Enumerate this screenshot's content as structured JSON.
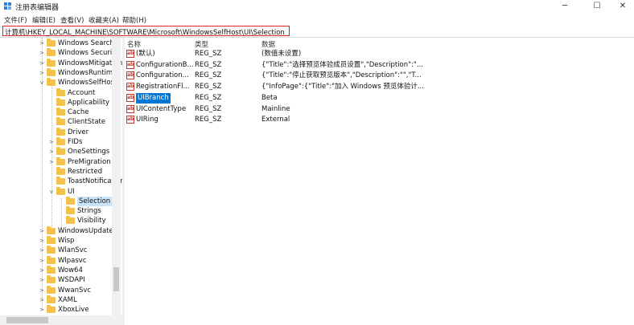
{
  "window": {
    "title": "注册表编辑器",
    "min_glyph": "─",
    "max_glyph": "☐",
    "close_glyph": "✕"
  },
  "menu": [
    {
      "label": "文件(F)"
    },
    {
      "label": "编辑(E)"
    },
    {
      "label": "查看(V)"
    },
    {
      "label": "收藏夹(A)"
    },
    {
      "label": "帮助(H)"
    }
  ],
  "address": {
    "path": "计算机\\HKEY_LOCAL_MACHINE\\SOFTWARE\\Microsoft\\WindowsSelfHost\\UI\\Selection"
  },
  "tree": [
    {
      "label": "Windows Search",
      "chevron": ">",
      "selected": false
    },
    {
      "label": "Windows Security",
      "chevron": ">",
      "selected": false
    },
    {
      "label": "WindowsMitigation",
      "chevron": ">",
      "selected": false
    },
    {
      "label": "WindowsRuntime",
      "chevron": ">",
      "selected": false
    },
    {
      "label": "WindowsSelfHost",
      "chevron": "v",
      "selected": false
    },
    {
      "label": "Account",
      "chevron": "",
      "selected": false
    },
    {
      "label": "Applicability",
      "chevron": "",
      "selected": false
    },
    {
      "label": "Cache",
      "chevron": "",
      "selected": false
    },
    {
      "label": "ClientState",
      "chevron": "",
      "selected": false
    },
    {
      "label": "Driver",
      "chevron": "",
      "selected": false
    },
    {
      "label": "FIDs",
      "chevron": ">",
      "selected": false
    },
    {
      "label": "OneSettings",
      "chevron": ">",
      "selected": false
    },
    {
      "label": "PreMigration",
      "chevron": ">",
      "selected": false
    },
    {
      "label": "Restricted",
      "chevron": "",
      "selected": false
    },
    {
      "label": "ToastNotification",
      "chevron": "",
      "selected": false
    },
    {
      "label": "UI",
      "chevron": "v",
      "selected": false
    },
    {
      "label": "Selection",
      "chevron": "",
      "selected": true
    },
    {
      "label": "Strings",
      "chevron": "",
      "selected": false
    },
    {
      "label": "Visibility",
      "chevron": "",
      "selected": false
    },
    {
      "label": "WindowsUpdate",
      "chevron": ">",
      "selected": false
    },
    {
      "label": "Wisp",
      "chevron": ">",
      "selected": false
    },
    {
      "label": "WlanSvc",
      "chevron": ">",
      "selected": false
    },
    {
      "label": "Wlpasvc",
      "chevron": ">",
      "selected": false
    },
    {
      "label": "Wow64",
      "chevron": ">",
      "selected": false
    },
    {
      "label": "WSDAPI",
      "chevron": ">",
      "selected": false
    },
    {
      "label": "WwanSvc",
      "chevron": ">",
      "selected": false
    },
    {
      "label": "XAML",
      "chevron": ">",
      "selected": false
    },
    {
      "label": "XboxLive",
      "chevron": ">",
      "selected": false
    }
  ],
  "columns": {
    "name": "名称",
    "type": "类型",
    "data": "数据"
  },
  "values": [
    {
      "name": "(默认)",
      "type": "REG_SZ",
      "data": "(数值未设置)",
      "selected": false
    },
    {
      "name": "ConfigurationB...",
      "type": "REG_SZ",
      "data": "{\"Title\":\"选择预览体验成员设置\",\"Description\":\"...",
      "selected": false
    },
    {
      "name": "Configuration...",
      "type": "REG_SZ",
      "data": "{\"Title\":\"停止获取预览版本\",\"Description\":\"\",\"T...",
      "selected": false
    },
    {
      "name": "RegistrationFl...",
      "type": "REG_SZ",
      "data": "{\"InfoPage\":{\"Title\":\"加入 Windows 预览体验计...",
      "selected": false
    },
    {
      "name": "UIBranch",
      "type": "REG_SZ",
      "data": "Beta",
      "selected": true
    },
    {
      "name": "UIContentType",
      "type": "REG_SZ",
      "data": "Mainline",
      "selected": false
    },
    {
      "name": "UIRing",
      "type": "REG_SZ",
      "data": "External",
      "selected": false
    }
  ],
  "icon_text": "ab",
  "colors": {
    "accent": "#0078d7",
    "folder": "#f2c24c",
    "highlight_border": "#e02020"
  }
}
